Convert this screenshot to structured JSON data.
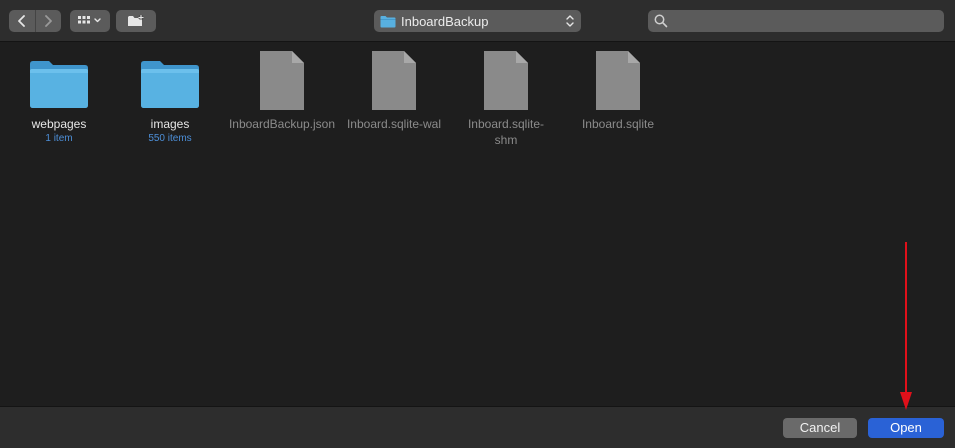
{
  "toolbar": {
    "back_icon": "chevron-left-icon",
    "forward_icon": "chevron-right-icon",
    "view_icon": "icon-grid-icon",
    "new_folder_icon": "new-folder-icon",
    "location": "InboardBackup",
    "search_placeholder": "",
    "search_value": ""
  },
  "files": [
    {
      "name": "webpages",
      "kind": "folder",
      "count": "1 item"
    },
    {
      "name": "images",
      "kind": "folder",
      "count": "550 items"
    },
    {
      "name": "InboardBackup.json",
      "kind": "document"
    },
    {
      "name": "Inboard.sqlite-wal",
      "kind": "document"
    },
    {
      "name": "Inboard.sqlite-shm",
      "kind": "document"
    },
    {
      "name": "Inboard.sqlite",
      "kind": "document"
    }
  ],
  "footer": {
    "cancel_label": "Cancel",
    "open_label": "Open"
  },
  "colors": {
    "folder": "#4fa6d6",
    "primary_button": "#2a62d6",
    "annotation_arrow": "#e0101a",
    "item_count": "#4d8fd8"
  }
}
